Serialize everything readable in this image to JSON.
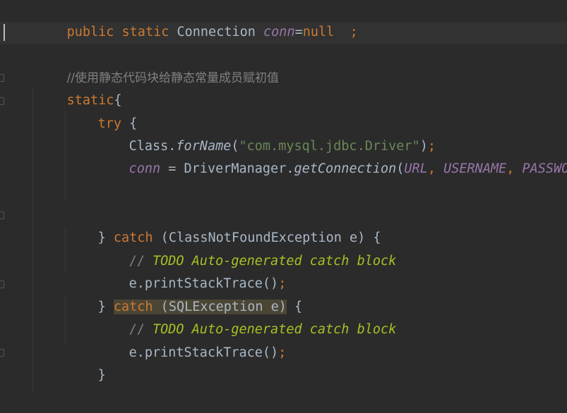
{
  "editor": {
    "lines": {
      "l1": {
        "kw1": "public",
        "kw2": "static",
        "type": "Connection",
        "field": "conn",
        "eq": "=",
        "val": "null",
        "pad": "  ",
        "semi": ";"
      },
      "l3": {
        "comment": "//使用静态代码块给静态常量成员赋初值"
      },
      "l4": {
        "kw": "static",
        "brace": "{"
      },
      "l5": {
        "kw": "try",
        "brace": " {"
      },
      "l6": {
        "cls": "Class.",
        "method": "forName",
        "open": "(",
        "str": "\"com.mysql.jdbc.Driver\"",
        "close": ")",
        "semi": ";"
      },
      "l7": {
        "field": "conn",
        "eq": " = DriverManager.",
        "method": "getConnection",
        "open": "(",
        "a1": "URL",
        "c1": ", ",
        "a2": "USERNAME",
        "c2": ", ",
        "a3": "PASSWORD",
        "close": ")",
        "semi": ";"
      },
      "l10": {
        "pre": "} ",
        "kw": "catch",
        "post": " (ClassNotFoundException e) {"
      },
      "l11": {
        "slashes": "// ",
        "todo": "TODO Auto-generated catch block"
      },
      "l12": {
        "call": "e.printStackTrace()",
        "semi": ";"
      },
      "l13": {
        "pre": "} ",
        "kw": "catch",
        "post": " (SQLException e)",
        "tail": " {"
      },
      "l14": {
        "slashes": "// ",
        "todo": "TODO Auto-generated catch block"
      },
      "l15": {
        "call": "e.printStackTrace()",
        "semi": ";"
      },
      "l16": {
        "brace": "}"
      },
      "l18": {
        "brace": "}"
      }
    }
  },
  "colors": {
    "background": "#2b2b2b",
    "keyword": "#cc7832",
    "text": "#a9b7c6",
    "field": "#9876aa",
    "string": "#6a8759",
    "comment": "#808080",
    "todo": "#a8c023",
    "highlight": "#4b4634"
  }
}
